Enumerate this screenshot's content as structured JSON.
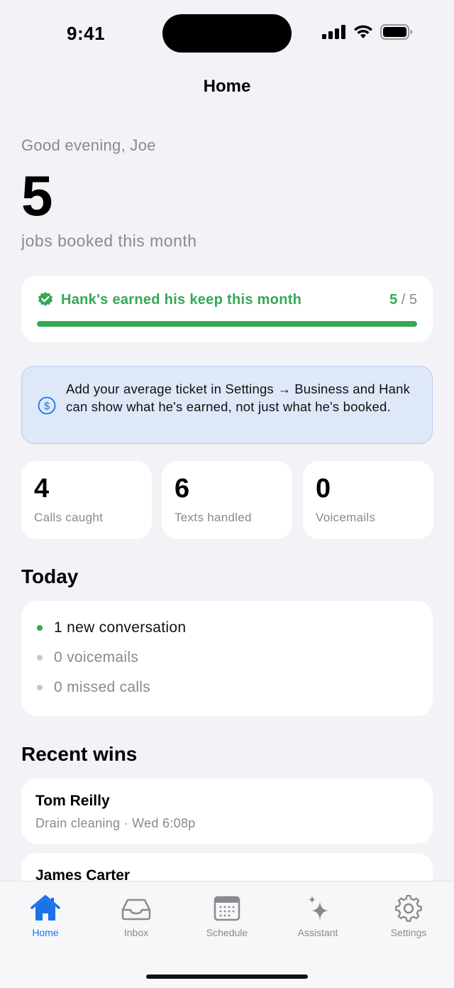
{
  "status_bar": {
    "time": "9:41"
  },
  "nav": {
    "title": "Home"
  },
  "greeting": "Good evening, Joe",
  "jobs": {
    "count": "5",
    "label": "jobs booked this month"
  },
  "keep": {
    "label": "Hank's earned his keep this month",
    "current": "5",
    "separator": " / ",
    "target": "5",
    "progress_fraction": 1.0
  },
  "info": {
    "text": "Add your average ticket in Settings → Business and Hank can show what he's earned, not just what he's booked."
  },
  "stats": [
    {
      "value": "4",
      "label": "Calls caught"
    },
    {
      "value": "6",
      "label": "Texts handled"
    },
    {
      "value": "0",
      "label": "Voicemails"
    }
  ],
  "today": {
    "title": "Today",
    "items": [
      {
        "text": "1 new conversation"
      },
      {
        "text": "0 voicemails"
      },
      {
        "text": "0 missed calls"
      }
    ]
  },
  "recent_wins": {
    "title": "Recent wins",
    "items": [
      {
        "name": "Tom Reilly",
        "detail": "Drain cleaning · Wed 6:08p"
      },
      {
        "name": "James Carter",
        "detail": ""
      }
    ]
  },
  "tabs": [
    {
      "label": "Home",
      "icon": "home-icon"
    },
    {
      "label": "Inbox",
      "icon": "inbox-icon"
    },
    {
      "label": "Schedule",
      "icon": "calendar-icon"
    },
    {
      "label": "Assistant",
      "icon": "sparkle-icon"
    },
    {
      "label": "Settings",
      "icon": "gear-icon"
    }
  ],
  "colors": {
    "accent_green": "#34a853",
    "accent_blue": "#1a73e8",
    "info_bg": "#dfe8f8",
    "muted_gray": "#8a8a8e"
  }
}
